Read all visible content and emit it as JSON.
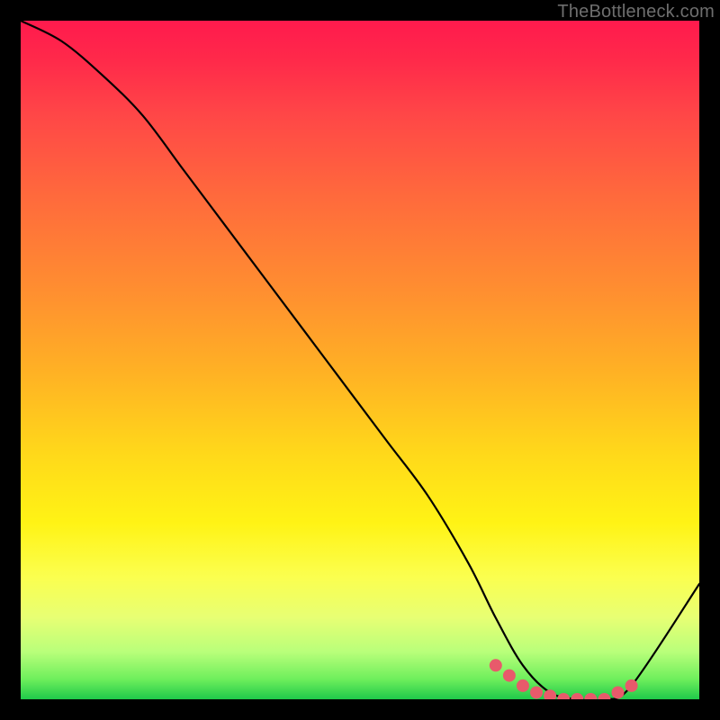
{
  "watermark": "TheBottleneck.com",
  "colors": {
    "background": "#000000",
    "curve_stroke": "#000000",
    "marker_fill": "#e85a6b",
    "marker_radius": 7
  },
  "chart_data": {
    "type": "line",
    "title": "",
    "xlabel": "",
    "ylabel": "",
    "xlim": [
      0,
      100
    ],
    "ylim": [
      0,
      100
    ],
    "grid": false,
    "legend": false,
    "annotations": [],
    "series": [
      {
        "name": "bottleneck-curve",
        "x": [
          0,
          6,
          12,
          18,
          24,
          30,
          36,
          42,
          48,
          54,
          60,
          66,
          70,
          74,
          78,
          82,
          86,
          90,
          100
        ],
        "values": [
          100,
          97,
          92,
          86,
          78,
          70,
          62,
          54,
          46,
          38,
          30,
          20,
          12,
          5,
          1,
          0,
          0,
          2,
          17
        ]
      }
    ],
    "markers": {
      "name": "optimal-range-dots",
      "x": [
        70,
        72,
        74,
        76,
        78,
        80,
        82,
        84,
        86,
        88,
        90
      ],
      "values": [
        5,
        3.5,
        2,
        1,
        0.5,
        0,
        0,
        0,
        0,
        1,
        2
      ]
    }
  }
}
